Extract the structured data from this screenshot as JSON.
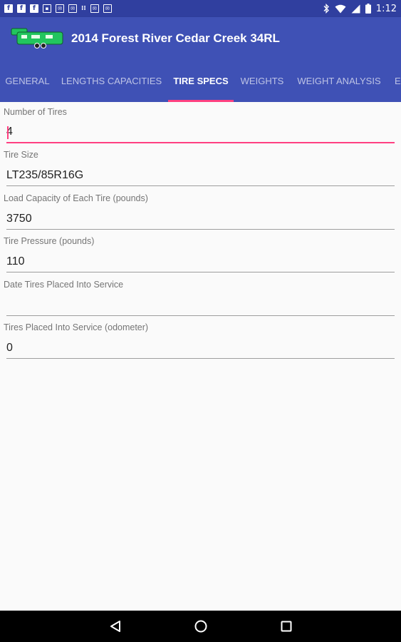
{
  "status_bar": {
    "time": "1:12",
    "notification_icons": [
      "facebook-icon",
      "facebook-icon",
      "facebook-icon",
      "image-icon",
      "email-icon",
      "email-icon",
      "wifi-signal-icon",
      "email-icon",
      "email-icon"
    ]
  },
  "app_bar": {
    "title": "2014 Forest River Cedar Creek 34RL",
    "logo_color": "#22c55e"
  },
  "tabs": [
    {
      "label": "GENERAL"
    },
    {
      "label": "LENGTHS CAPACITIES"
    },
    {
      "label": "TIRE SPECS"
    },
    {
      "label": "WEIGHTS"
    },
    {
      "label": "WEIGHT ANALYSIS"
    },
    {
      "label": "E"
    }
  ],
  "form": {
    "fields": [
      {
        "label": "Number of Tires",
        "value": "4"
      },
      {
        "label": "Tire Size",
        "value": "LT235/85R16G"
      },
      {
        "label": "Load Capacity of Each Tire (pounds)",
        "value": "3750"
      },
      {
        "label": "Tire Pressure (pounds)",
        "value": "110"
      },
      {
        "label": "Date Tires Placed Into Service",
        "value": ""
      },
      {
        "label": "Tires Placed Into Service (odometer)",
        "value": "0"
      }
    ]
  },
  "colors": {
    "primary": "#3f51b5",
    "primary_dark": "#303f9f",
    "accent": "#ff4081"
  }
}
